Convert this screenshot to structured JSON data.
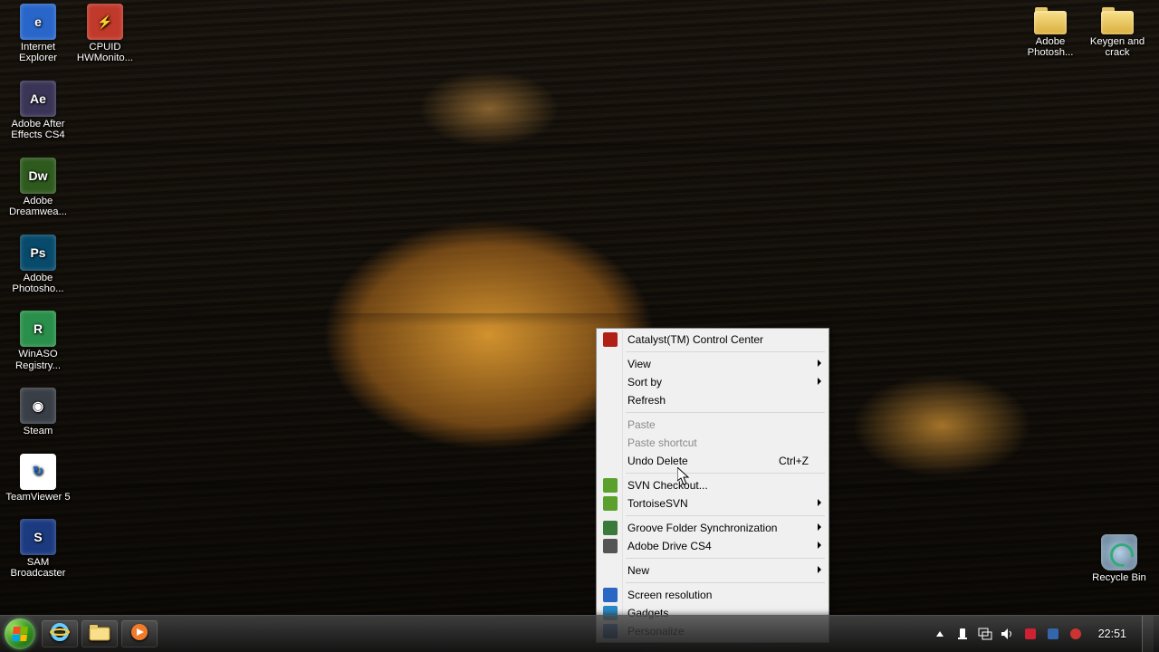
{
  "desktop_icons_left": [
    {
      "id": "ie",
      "label": "Internet Explorer",
      "bg": "#2966c9",
      "glyph": "e"
    },
    {
      "id": "cpuid",
      "label": "CPUID HWMonito...",
      "bg": "#c0392b",
      "glyph": "⚡"
    },
    {
      "id": "ae",
      "label": "Adobe After Effects CS4",
      "bg": "#3a3456",
      "glyph": "Ae"
    },
    {
      "id": "dw",
      "label": "Adobe Dreamwea...",
      "bg": "#2e5a1e",
      "glyph": "Dw"
    },
    {
      "id": "ps",
      "label": "Adobe Photosho...",
      "bg": "#074a6b",
      "glyph": "Ps"
    },
    {
      "id": "winaso",
      "label": "WinASO Registry...",
      "bg": "#2a8f4a",
      "glyph": "R"
    },
    {
      "id": "steam",
      "label": "Steam",
      "bg": "#3a3f47",
      "glyph": "◉"
    },
    {
      "id": "teamviewer",
      "label": "TeamViewer 5",
      "bg": "#ffffff",
      "glyph": "↻",
      "fg": "#1366c4"
    },
    {
      "id": "sam",
      "label": "SAM Broadcaster",
      "bg": "#1c3a80",
      "glyph": "S"
    }
  ],
  "desktop_icons_right": [
    {
      "id": "adobeps-folder",
      "label": "Adobe Photosh...",
      "type": "folder"
    },
    {
      "id": "keygen-folder",
      "label": "Keygen and crack",
      "type": "folder"
    }
  ],
  "recycle_bin": {
    "label": "Recycle Bin"
  },
  "context_menu": {
    "items": [
      {
        "id": "ccc",
        "label": "Catalyst(TM) Control Center",
        "icon": "#b02015"
      },
      {
        "sep": true
      },
      {
        "id": "view",
        "label": "View",
        "submenu": true
      },
      {
        "id": "sortby",
        "label": "Sort by",
        "submenu": true
      },
      {
        "id": "refresh",
        "label": "Refresh"
      },
      {
        "sep": true
      },
      {
        "id": "paste",
        "label": "Paste",
        "disabled": true
      },
      {
        "id": "pasteshortcut",
        "label": "Paste shortcut",
        "disabled": true
      },
      {
        "id": "undodelete",
        "label": "Undo Delete",
        "shortcut": "Ctrl+Z"
      },
      {
        "sep": true
      },
      {
        "id": "svncheckout",
        "label": "SVN Checkout...",
        "icon": "#5aa02c"
      },
      {
        "id": "tortoisesvn",
        "label": "TortoiseSVN",
        "submenu": true,
        "icon": "#5aa02c"
      },
      {
        "sep": true
      },
      {
        "id": "groove",
        "label": "Groove Folder Synchronization",
        "submenu": true,
        "icon": "#3a7a3a"
      },
      {
        "id": "adobedrive",
        "label": "Adobe Drive CS4",
        "submenu": true,
        "icon": "#555"
      },
      {
        "sep": true
      },
      {
        "id": "new",
        "label": "New",
        "submenu": true
      },
      {
        "sep": true
      },
      {
        "id": "screenres",
        "label": "Screen resolution",
        "icon": "#2a66c4"
      },
      {
        "id": "gadgets",
        "label": "Gadgets",
        "icon": "#2a88c4"
      },
      {
        "id": "personalize",
        "label": "Personalize",
        "icon": "#2a66c4"
      }
    ]
  },
  "taskbar": {
    "pinned": [
      {
        "id": "ie",
        "name": "internet-explorer-icon",
        "color": "#2966c9"
      },
      {
        "id": "explorer",
        "name": "file-explorer-icon",
        "color": "#e7c767"
      },
      {
        "id": "wmp",
        "name": "media-player-icon",
        "color": "#f07b2b"
      }
    ],
    "tray": {
      "icons": [
        "up-arrow",
        "action-center",
        "network",
        "volume",
        "shield",
        "app1",
        "app2"
      ],
      "clock": "22:51"
    }
  }
}
